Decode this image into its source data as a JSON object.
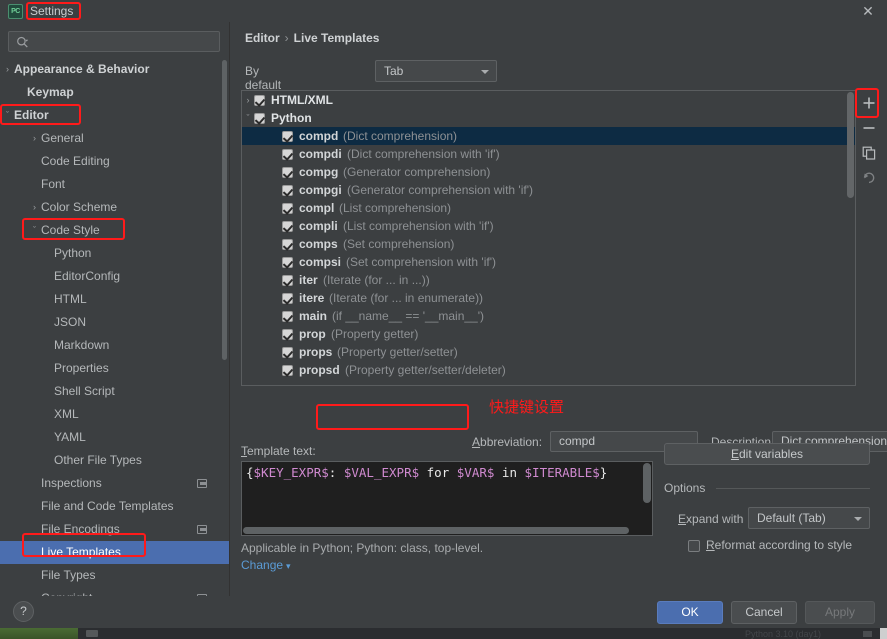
{
  "window": {
    "title": "Settings",
    "app_icon_text": "PC",
    "close_icon": "close-icon"
  },
  "sidebar": {
    "search": {
      "value": "",
      "placeholder": "",
      "icon": "search-icon"
    },
    "items": [
      {
        "label": "Appearance & Behavior",
        "indent": 14,
        "arrow": "›",
        "bold": true,
        "selected": false,
        "scope": false
      },
      {
        "label": "Keymap",
        "indent": 27,
        "arrow": "",
        "bold": true,
        "selected": false,
        "scope": false
      },
      {
        "label": "Editor",
        "indent": 14,
        "arrow": "ˇ",
        "bold": true,
        "selected": false,
        "scope": false
      },
      {
        "label": "General",
        "indent": 41,
        "arrow": "›",
        "bold": false,
        "selected": false,
        "scope": false
      },
      {
        "label": "Code Editing",
        "indent": 41,
        "arrow": "",
        "bold": false,
        "selected": false,
        "scope": false
      },
      {
        "label": "Font",
        "indent": 41,
        "arrow": "",
        "bold": false,
        "selected": false,
        "scope": false
      },
      {
        "label": "Color Scheme",
        "indent": 41,
        "arrow": "›",
        "bold": false,
        "selected": false,
        "scope": false
      },
      {
        "label": "Code Style",
        "indent": 41,
        "arrow": "ˇ",
        "bold": false,
        "selected": false,
        "scope": false
      },
      {
        "label": "Python",
        "indent": 54,
        "arrow": "",
        "bold": false,
        "selected": false,
        "scope": false
      },
      {
        "label": "EditorConfig",
        "indent": 54,
        "arrow": "",
        "bold": false,
        "selected": false,
        "scope": false
      },
      {
        "label": "HTML",
        "indent": 54,
        "arrow": "",
        "bold": false,
        "selected": false,
        "scope": false
      },
      {
        "label": "JSON",
        "indent": 54,
        "arrow": "",
        "bold": false,
        "selected": false,
        "scope": false
      },
      {
        "label": "Markdown",
        "indent": 54,
        "arrow": "",
        "bold": false,
        "selected": false,
        "scope": false
      },
      {
        "label": "Properties",
        "indent": 54,
        "arrow": "",
        "bold": false,
        "selected": false,
        "scope": false
      },
      {
        "label": "Shell Script",
        "indent": 54,
        "arrow": "",
        "bold": false,
        "selected": false,
        "scope": false
      },
      {
        "label": "XML",
        "indent": 54,
        "arrow": "",
        "bold": false,
        "selected": false,
        "scope": false
      },
      {
        "label": "YAML",
        "indent": 54,
        "arrow": "",
        "bold": false,
        "selected": false,
        "scope": false
      },
      {
        "label": "Other File Types",
        "indent": 54,
        "arrow": "",
        "bold": false,
        "selected": false,
        "scope": false
      },
      {
        "label": "Inspections",
        "indent": 41,
        "arrow": "",
        "bold": false,
        "selected": false,
        "scope": true
      },
      {
        "label": "File and Code Templates",
        "indent": 41,
        "arrow": "",
        "bold": false,
        "selected": false,
        "scope": false
      },
      {
        "label": "File Encodings",
        "indent": 41,
        "arrow": "",
        "bold": false,
        "selected": false,
        "scope": true
      },
      {
        "label": "Live Templates",
        "indent": 41,
        "arrow": "",
        "bold": false,
        "selected": true,
        "scope": false
      },
      {
        "label": "File Types",
        "indent": 41,
        "arrow": "",
        "bold": false,
        "selected": false,
        "scope": false
      },
      {
        "label": "Copyright",
        "indent": 41,
        "arrow": "›",
        "bold": false,
        "selected": false,
        "scope": true
      }
    ]
  },
  "main": {
    "breadcrumb": {
      "parent": "Editor",
      "separator": "›",
      "current": "Live Templates"
    },
    "expand_with": {
      "label": "By default expand with",
      "value": "Tab"
    },
    "toolbar": [
      {
        "name": "add-template-button",
        "icon": "plus-icon"
      },
      {
        "name": "remove-template-button",
        "icon": "minus-icon"
      },
      {
        "name": "duplicate-template-button",
        "icon": "copy-icon"
      },
      {
        "name": "revert-template-button",
        "icon": "undo-icon"
      }
    ],
    "template_list": [
      {
        "abbr": "HTML/XML",
        "desc": "",
        "indent": 12,
        "arrow": "›",
        "group": true,
        "checked": true,
        "selected": false
      },
      {
        "abbr": "Python",
        "desc": "",
        "indent": 12,
        "arrow": "ˇ",
        "group": true,
        "checked": true,
        "selected": false
      },
      {
        "abbr": "compd",
        "desc": "(Dict comprehension)",
        "indent": 40,
        "arrow": "",
        "group": false,
        "checked": true,
        "selected": true
      },
      {
        "abbr": "compdi",
        "desc": "(Dict comprehension with 'if')",
        "indent": 40,
        "arrow": "",
        "group": false,
        "checked": true,
        "selected": false
      },
      {
        "abbr": "compg",
        "desc": "(Generator comprehension)",
        "indent": 40,
        "arrow": "",
        "group": false,
        "checked": true,
        "selected": false
      },
      {
        "abbr": "compgi",
        "desc": "(Generator comprehension with 'if')",
        "indent": 40,
        "arrow": "",
        "group": false,
        "checked": true,
        "selected": false
      },
      {
        "abbr": "compl",
        "desc": "(List comprehension)",
        "indent": 40,
        "arrow": "",
        "group": false,
        "checked": true,
        "selected": false
      },
      {
        "abbr": "compli",
        "desc": "(List comprehension with 'if')",
        "indent": 40,
        "arrow": "",
        "group": false,
        "checked": true,
        "selected": false
      },
      {
        "abbr": "comps",
        "desc": "(Set comprehension)",
        "indent": 40,
        "arrow": "",
        "group": false,
        "checked": true,
        "selected": false
      },
      {
        "abbr": "compsi",
        "desc": "(Set comprehension with 'if')",
        "indent": 40,
        "arrow": "",
        "group": false,
        "checked": true,
        "selected": false
      },
      {
        "abbr": "iter",
        "desc": "(Iterate (for ... in ...))",
        "indent": 40,
        "arrow": "",
        "group": false,
        "checked": true,
        "selected": false
      },
      {
        "abbr": "itere",
        "desc": "(Iterate (for ... in enumerate))",
        "indent": 40,
        "arrow": "",
        "group": false,
        "checked": true,
        "selected": false
      },
      {
        "abbr": "main",
        "desc": "(if __name__ == '__main__')",
        "indent": 40,
        "arrow": "",
        "group": false,
        "checked": true,
        "selected": false
      },
      {
        "abbr": "prop",
        "desc": "(Property getter)",
        "indent": 40,
        "arrow": "",
        "group": false,
        "checked": true,
        "selected": false
      },
      {
        "abbr": "props",
        "desc": "(Property getter/setter)",
        "indent": 40,
        "arrow": "",
        "group": false,
        "checked": true,
        "selected": false
      },
      {
        "abbr": "propsd",
        "desc": "(Property getter/setter/deleter)",
        "indent": 40,
        "arrow": "",
        "group": false,
        "checked": true,
        "selected": false
      }
    ],
    "abbreviation": {
      "label": "Abbreviation:",
      "value": "compd"
    },
    "description": {
      "label": "Description:",
      "value": "Dict comprehension"
    },
    "template_text": {
      "label": "Template text:",
      "value": "{$KEY_EXPR$: $VAL_EXPR$ for $VAR$ in $ITERABLE$}",
      "tokens": [
        {
          "t": "{",
          "c": "punc"
        },
        {
          "t": "$KEY_EXPR$",
          "c": "var"
        },
        {
          "t": ": ",
          "c": "punc"
        },
        {
          "t": "$VAL_EXPR$",
          "c": "var"
        },
        {
          "t": " for ",
          "c": "kw"
        },
        {
          "t": "$VAR$",
          "c": "var"
        },
        {
          "t": " in ",
          "c": "kw"
        },
        {
          "t": "$ITERABLE$",
          "c": "var"
        },
        {
          "t": "}",
          "c": "punc"
        }
      ]
    },
    "applicable": "Applicable in Python; Python: class, top-level.",
    "change_link": "Change",
    "edit_variables_button": "Edit variables",
    "options": {
      "title": "Options",
      "expand_with_label": "Expand with",
      "expand_with_value": "Default (Tab)",
      "reformat_label": "Reformat according to style",
      "reformat_checked": false
    }
  },
  "footer": {
    "help": "?",
    "ok": "OK",
    "cancel": "Cancel",
    "apply": "Apply"
  },
  "annotations": {
    "shortcut_note": "快捷键设置"
  },
  "colors": {
    "accent_blue": "#4b6eaf",
    "annotation_red": "#ff1a1a",
    "selected_row": "#0d2b43",
    "panel_bg": "#3c3f41",
    "code_bg": "#1f1f1f"
  }
}
